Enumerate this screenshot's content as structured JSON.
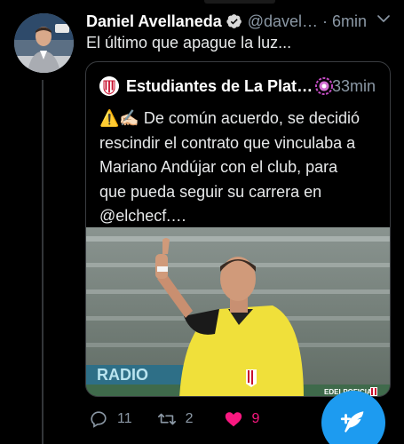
{
  "tweet": {
    "author_name": "Daniel Avellaneda",
    "handle": "@davel…",
    "separator": "·",
    "time": "6min",
    "text": "El último que apague la luz..."
  },
  "quote": {
    "author_name": "Estudiantes de La Plata…",
    "time": "33min",
    "lines": [
      "⚠️✍🏻 De común acuerdo, se decidió",
      "rescindir el contrato que vinculaba a",
      "Mariano Andújar con el club, para",
      "que pueda seguir su carrera en",
      "@elchecf.…"
    ],
    "image_watermark": "EDELPOFICIAL",
    "image_ad_text": "RADIO"
  },
  "actions": {
    "reply_count": "11",
    "retweet_count": "2",
    "like_count": "9"
  },
  "colors": {
    "background": "#000000",
    "accent": "#1d9bf0",
    "like": "#f91880",
    "muted": "#8b98a5",
    "border": "#3a3d41"
  },
  "icons": {
    "verified": "verified-badge-icon",
    "chevron": "chevron-down-icon",
    "reply": "reply-icon",
    "retweet": "retweet-icon",
    "like": "heart-icon",
    "compose": "compose-tweet-icon"
  }
}
